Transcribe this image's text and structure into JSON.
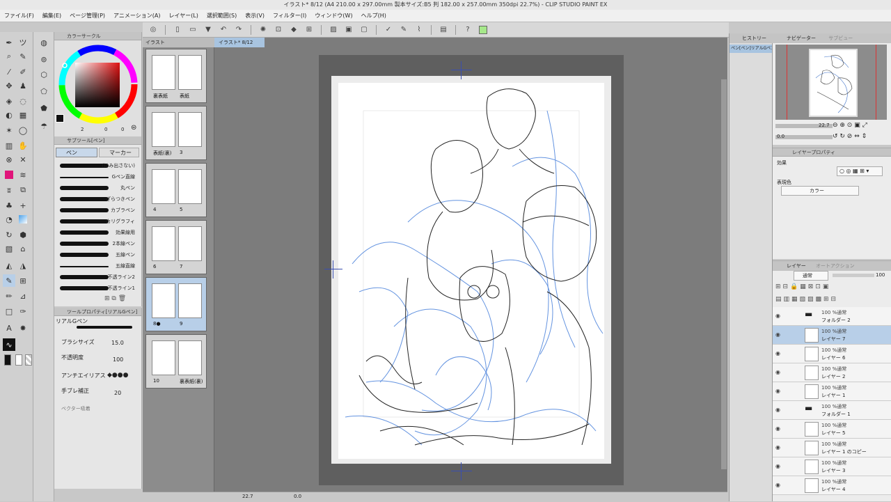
{
  "window": {
    "title": "イラスト* 8/12 (A4 210.00 x 297.00mm 製本サイズ:B5 判 182.00 x 257.00mm 350dpi 22.7%) - CLIP STUDIO PAINT EX"
  },
  "menu": [
    "ファイル(F)",
    "編集(E)",
    "ページ管理(P)",
    "アニメーション(A)",
    "レイヤー(L)",
    "選択範囲(S)",
    "表示(V)",
    "フィルター(I)",
    "ウィンドウ(W)",
    "ヘルプ(H)"
  ],
  "panels": {
    "color_circle": "カラーサークル",
    "subtool_title": "サブツール[ペン]",
    "subtool_tabs": [
      "ペン",
      "マーカー"
    ],
    "toolprop_title": "ツールプロパティ[リアルGペン]",
    "navigator": "ナビゲーター",
    "navigator_sub": "サブビュー",
    "history": "ヒストリー",
    "history_item": "ペン[ペン]リアルGペン",
    "layerprop_title": "レイヤープロパティ",
    "layers_title": "レイヤー",
    "autoaction": "オートアクション"
  },
  "color_values": {
    "h": "2",
    "s": "0",
    "v": "0"
  },
  "brushes": [
    "(はみ出さない)",
    "Gペン直線",
    "丸ペン",
    "ざらつきペン",
    "カブラペン",
    "カリグラフィ",
    "効果線用",
    "2本線ペン",
    "五線ペン",
    "五線直線",
    "不透ライン2",
    "不透ライン1"
  ],
  "toolprop": {
    "brush_name": "リアルGペン",
    "brush_size_label": "ブラシサイズ",
    "brush_size": "15.0",
    "opacity_label": "不透明度",
    "opacity": "100",
    "antialias_label": "アンチエイリアス",
    "stabilize_label": "手ブレ補正",
    "stabilize": "20",
    "vector_label": "ベクター吸着"
  },
  "page_tab": "イラスト",
  "canvas_tab": "イラスト* 8/12",
  "pages": [
    {
      "labels": [
        "裏表紙",
        "表紙"
      ]
    },
    {
      "labels": [
        "表紙(裏)",
        "3"
      ]
    },
    {
      "labels": [
        "4",
        "5"
      ]
    },
    {
      "labels": [
        "6",
        "7"
      ]
    },
    {
      "labels": [
        "8●",
        "9"
      ]
    },
    {
      "labels": [
        "10",
        "裏表紙(裏)"
      ]
    }
  ],
  "navigator_zoom": "22.7",
  "navigator_angle": "0.0",
  "layerprop": {
    "effect_label": "効果",
    "expression_label": "表現色",
    "expression_value": "カラー"
  },
  "layers": {
    "blend": "通常",
    "opacity": "100",
    "items": [
      {
        "line1": "100 %通常",
        "name": "フォルダー 2",
        "type": "folder"
      },
      {
        "line1": "100 %通常",
        "name": "レイヤー 7",
        "selected": true
      },
      {
        "line1": "100 %通常",
        "name": "レイヤー 6"
      },
      {
        "line1": "100 %通常",
        "name": "レイヤー 2"
      },
      {
        "line1": "100 %通常",
        "name": "レイヤー 1"
      },
      {
        "line1": "100 %通常",
        "name": "フォルダー 1",
        "type": "folder"
      },
      {
        "line1": "100 %通常",
        "name": "レイヤー 5"
      },
      {
        "line1": "100 %通常",
        "name": "レイヤー 1 のコピー"
      },
      {
        "line1": "100 %通常",
        "name": "レイヤー 3"
      },
      {
        "line1": "100 %通常",
        "name": "レイヤー 4"
      }
    ]
  },
  "status": {
    "zoom": "22.7",
    "angle": "0.0"
  },
  "colors": {
    "accent": "#b8cfe8",
    "fg_swatch": "#111111",
    "sketch_blue": "#2f6fd6"
  }
}
